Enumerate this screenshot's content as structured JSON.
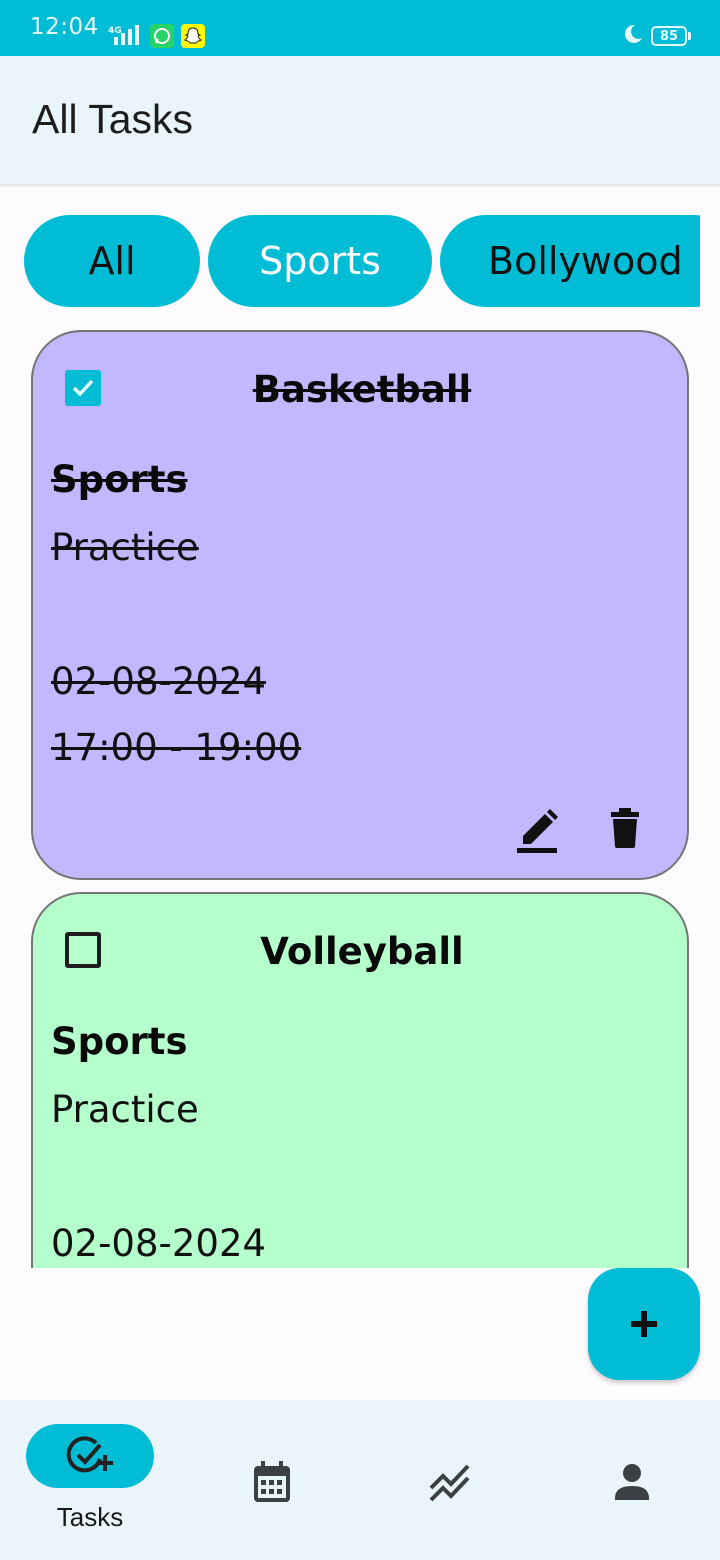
{
  "status_bar": {
    "time": "12:04",
    "network": "4G",
    "battery": "85"
  },
  "header": {
    "title": "All Tasks"
  },
  "filters": [
    {
      "label": "All"
    },
    {
      "label": "Sports"
    },
    {
      "label": "Bollywood"
    }
  ],
  "tasks": [
    {
      "title": "Basketball",
      "category": "Sports",
      "description": "Practice",
      "date": "02-08-2024",
      "time": "17:00 - 19:00",
      "completed": true,
      "color": "#c2b8ff"
    },
    {
      "title": "Volleyball",
      "category": "Sports",
      "description": "Practice",
      "date": "02-08-2024",
      "completed": false,
      "color": "#b5ffcc"
    }
  ],
  "fab": {
    "icon": "plus-icon"
  },
  "bottom_nav": [
    {
      "label": "Tasks",
      "icon": "task-check-add-icon",
      "active": true
    },
    {
      "label": "",
      "icon": "calendar-icon",
      "active": false
    },
    {
      "label": "",
      "icon": "trend-chart-icon",
      "active": false
    },
    {
      "label": "",
      "icon": "profile-icon",
      "active": false
    }
  ],
  "colors": {
    "accent": "#00bcd4",
    "app_bar": "#e9f5fa",
    "background": "#fefbfe"
  }
}
